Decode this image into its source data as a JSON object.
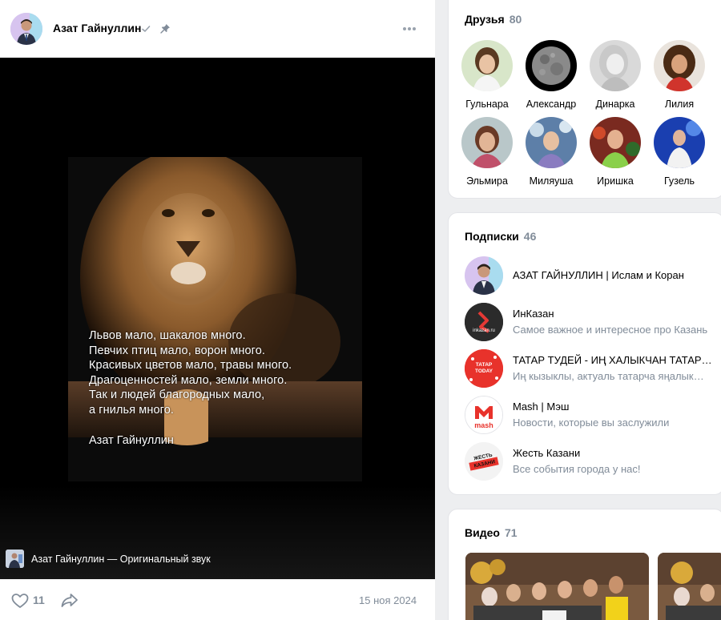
{
  "post": {
    "author_name": "Азат Гайнуллин",
    "quote_lines": [
      "Львов мало, шакалов много.",
      "Певчих птиц мало, ворон много.",
      "Красивых цветов мало, травы много.",
      "Драгоценностей мало, земли много.",
      "Так и людей благородных мало,",
      "а гнилья много."
    ],
    "quote_signature": "Азат Гайнуллин",
    "audio_label": "Азат Гайнуллин — Оригинальный звук",
    "like_count": "11",
    "date": "15 ноя 2024"
  },
  "friends": {
    "title": "Друзья",
    "count": "80",
    "items": [
      {
        "name": "Гульнара"
      },
      {
        "name": "Александр"
      },
      {
        "name": "Динарка"
      },
      {
        "name": "Лилия"
      },
      {
        "name": "Эльмира"
      },
      {
        "name": "Миляуша"
      },
      {
        "name": "Иришка"
      },
      {
        "name": "Гузель"
      }
    ]
  },
  "subscriptions": {
    "title": "Подписки",
    "count": "46",
    "items": [
      {
        "name": "АЗАТ ГАЙНУЛЛИН | Ислам и Коран",
        "desc": ""
      },
      {
        "name": "ИнКазан",
        "desc": "Самое важное и интересное про Казань",
        "logo_text": "inkazan.ru"
      },
      {
        "name": "ТАТАР ТУДЕЙ - ИҢ ХАЛЫКЧАН ТАТАР ПАБЛИГЫ",
        "desc": "Иң кызыклы, актуаль татарча яңалыклар",
        "logo_text": "ТАТАР TODAY"
      },
      {
        "name": "Mash | Мэш",
        "desc": "Новости, которые вы заслужили",
        "logo_text": "mash"
      },
      {
        "name": "Жесть Казани",
        "desc": "Все события города у нас!",
        "logo_text": "ЖЕСТЬ КАЗАНИ"
      }
    ]
  },
  "videos": {
    "title": "Видео",
    "count": "71"
  }
}
